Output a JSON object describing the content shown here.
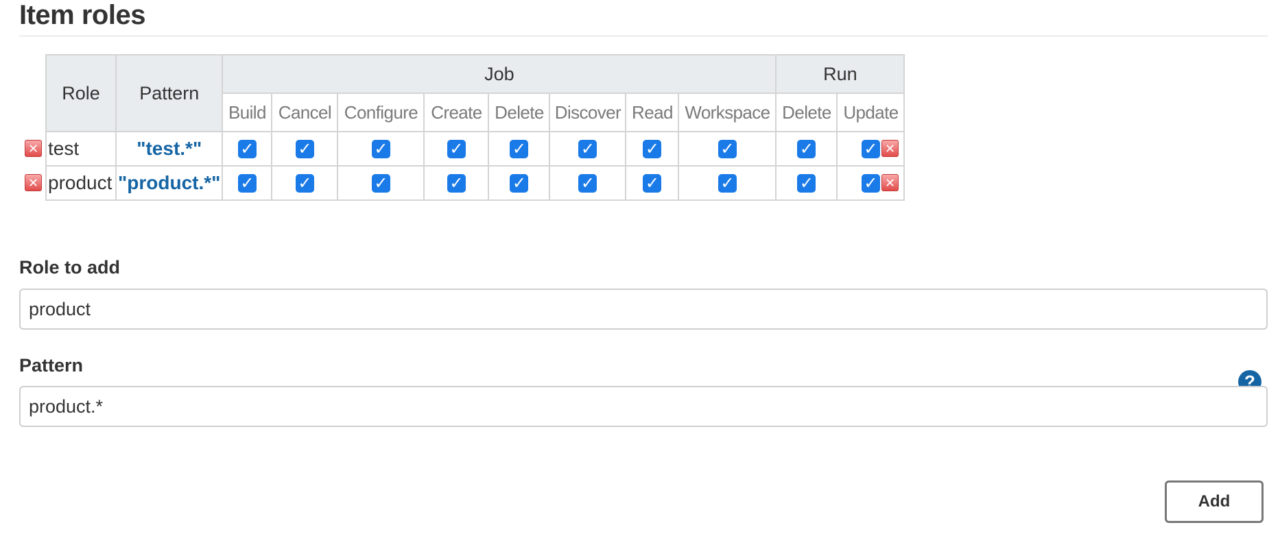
{
  "section": {
    "title": "Item roles"
  },
  "table": {
    "role_header": "Role",
    "pattern_header": "Pattern",
    "groups": [
      {
        "name": "Job",
        "permissions": [
          "Build",
          "Cancel",
          "Configure",
          "Create",
          "Delete",
          "Discover",
          "Read",
          "Workspace"
        ]
      },
      {
        "name": "Run",
        "permissions": [
          "Delete",
          "Update"
        ]
      }
    ],
    "rows": [
      {
        "role": "test",
        "pattern": "\"test.*\"",
        "checked": [
          true,
          true,
          true,
          true,
          true,
          true,
          true,
          true,
          true,
          true
        ]
      },
      {
        "role": "product",
        "pattern": "\"product.*\"",
        "checked": [
          true,
          true,
          true,
          true,
          true,
          true,
          true,
          true,
          true,
          true
        ]
      }
    ]
  },
  "form": {
    "role_label": "Role to add",
    "role_value": "product",
    "pattern_label": "Pattern",
    "pattern_value": "product.*",
    "help_icon": "question-mark-icon",
    "add_label": "Add"
  },
  "icons": {
    "delete": "delete-x-icon",
    "checkbox": "checkbox-checked-icon"
  },
  "colors": {
    "accent": "#1a7ae8",
    "link": "#1565a5",
    "delete": "#e24b4b"
  }
}
